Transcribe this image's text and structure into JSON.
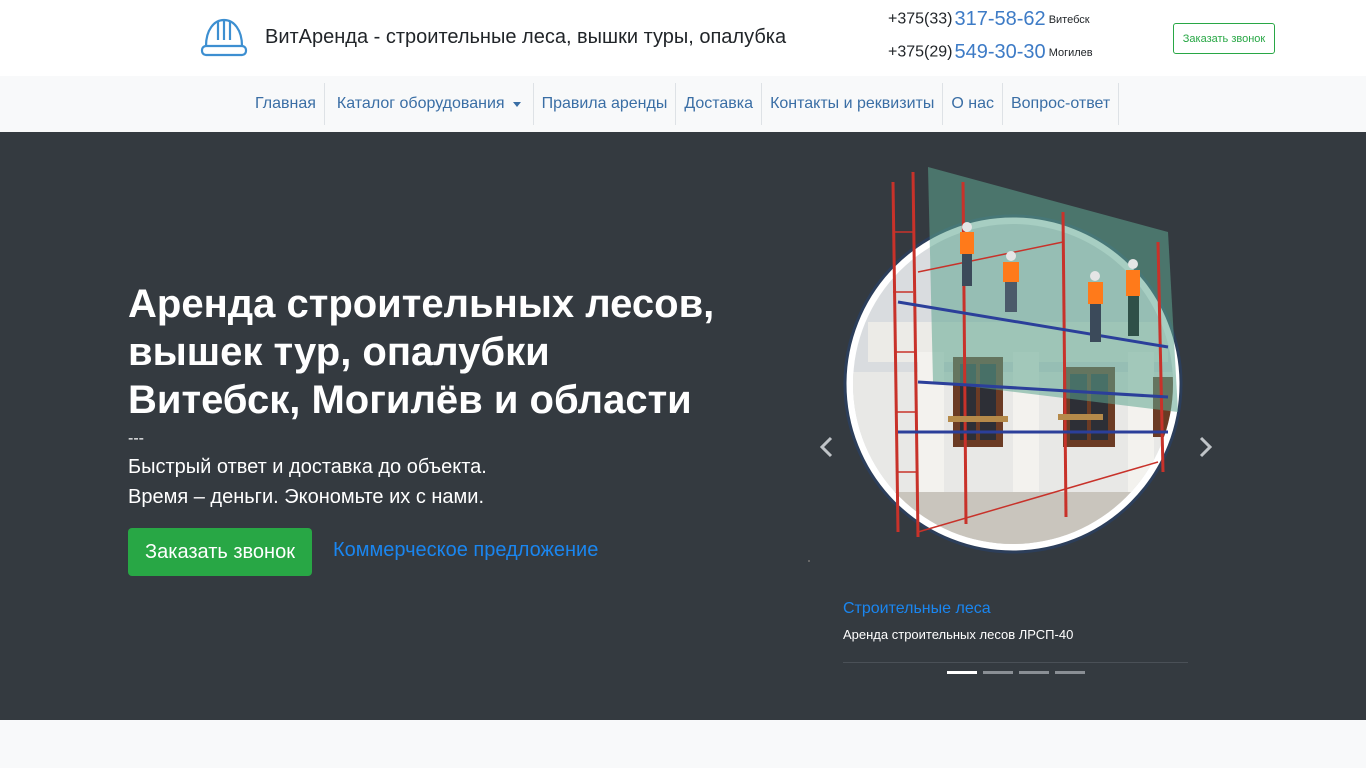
{
  "header": {
    "logo_icon": "hard-hat-icon",
    "site_title": "ВитАренда - строительные леса, вышки туры, опалубка",
    "phones": [
      {
        "code": "+375(33)",
        "number": "317-58-62",
        "city": "Витебск"
      },
      {
        "code": "+375(29)",
        "number": "549-30-30",
        "city": "Могилев"
      }
    ],
    "callback_label": "Заказать звонок"
  },
  "nav": {
    "items": [
      {
        "label": "Главная"
      },
      {
        "label": "Каталог оборудования"
      },
      {
        "label": "Правила аренды"
      },
      {
        "label": "Доставка"
      },
      {
        "label": "Контакты и реквизиты"
      },
      {
        "label": "О нас"
      },
      {
        "label": "Вопрос-ответ"
      }
    ]
  },
  "hero": {
    "title_lines": [
      "Аренда строительных лесов,",
      "вышек тур, опалубки",
      "Витебск, Могилёв и области"
    ],
    "separator": "---",
    "subtitle_lines": [
      "Быстрый ответ и доставка до объекта.",
      "Время – деньги. Экономьте их с нами."
    ],
    "cta_label": "Заказать звонок",
    "link_label": "Коммерческое предложение"
  },
  "carousel": {
    "caption_title": "Строительные леса",
    "caption_text": "Аренда строительных лесов ЛРСП-40",
    "slide_count": 4,
    "active_index": 0
  },
  "colors": {
    "accent_green": "#28a745",
    "link_blue": "#1a86f0",
    "hero_bg": "#343a40"
  }
}
